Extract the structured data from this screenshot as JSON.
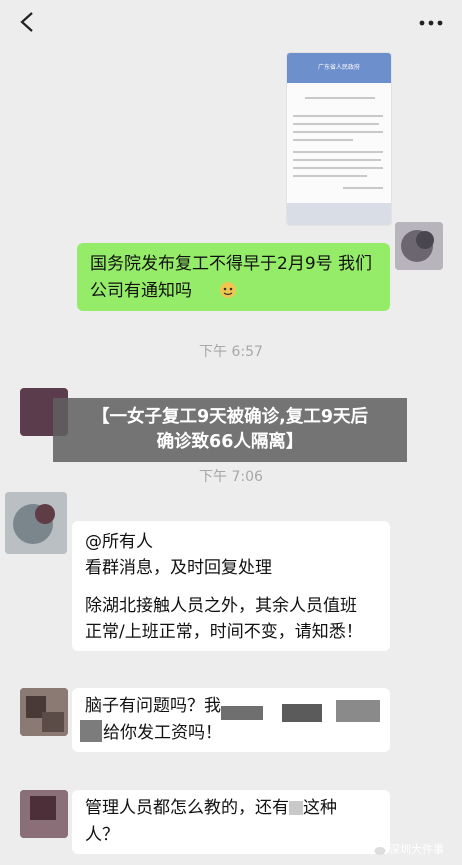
{
  "doc_thumbnail": {
    "header_title": "广东省人民政府"
  },
  "messages": {
    "green": "国务院发布复工不得早于2月9号 我们公司有通知吗",
    "time1": "下午 6:57",
    "time2": "下午 7:06",
    "notice_line1": "@所有人",
    "notice_line2": "看群消息，及时回复处理",
    "notice_line3": "除湖北接触人员之外，其余人员值班",
    "notice_line4": "正常/上班正常，时间不变，请知悉！",
    "msg3_line1": "脑子有问题吗？我",
    "msg3_line2": "给你发工资吗！",
    "msg4_line1": "管理人员都怎么教的，还有",
    "msg4_line1_end": "这种",
    "msg4_line2": "人？"
  },
  "overlay": {
    "line1": "【一女子复工9天被确诊,复工9天后",
    "line2": "确诊致66人隔离】"
  },
  "watermark": {
    "text": "深圳大件事",
    "icon": "wechat-icon"
  },
  "colors": {
    "chat_background": "#ededed",
    "sent_bubble": "#95ec69",
    "received_bubble": "#ffffff",
    "overlay": "#5f5f5f"
  }
}
